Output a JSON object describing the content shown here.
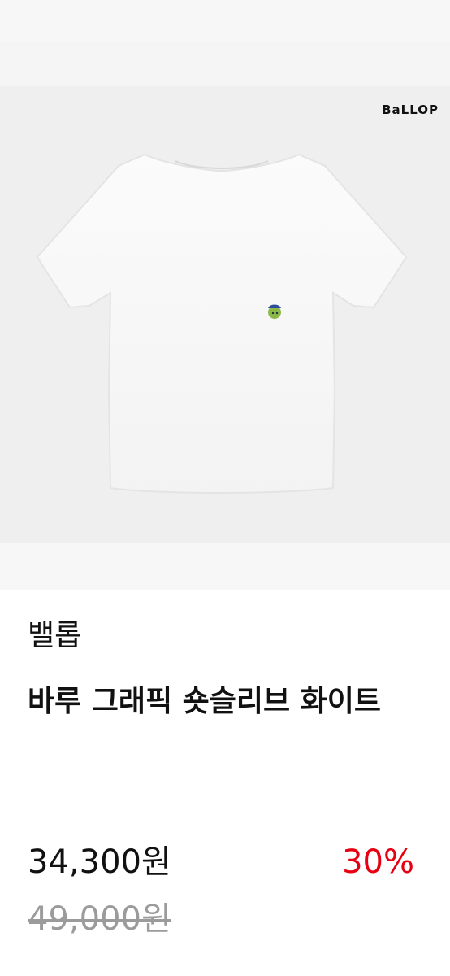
{
  "product_image": {
    "brand_logo": "BaLLOP",
    "icon": "tshirt-image"
  },
  "product": {
    "brand": "밸롭",
    "name": "바루 그래픽 숏슬리브 화이트",
    "sale_price": "34,300원",
    "discount": "30%",
    "original_price": "49,000원"
  },
  "colors": {
    "discount": "#e60012",
    "original_price": "#9b9b9b",
    "text": "#111111"
  }
}
